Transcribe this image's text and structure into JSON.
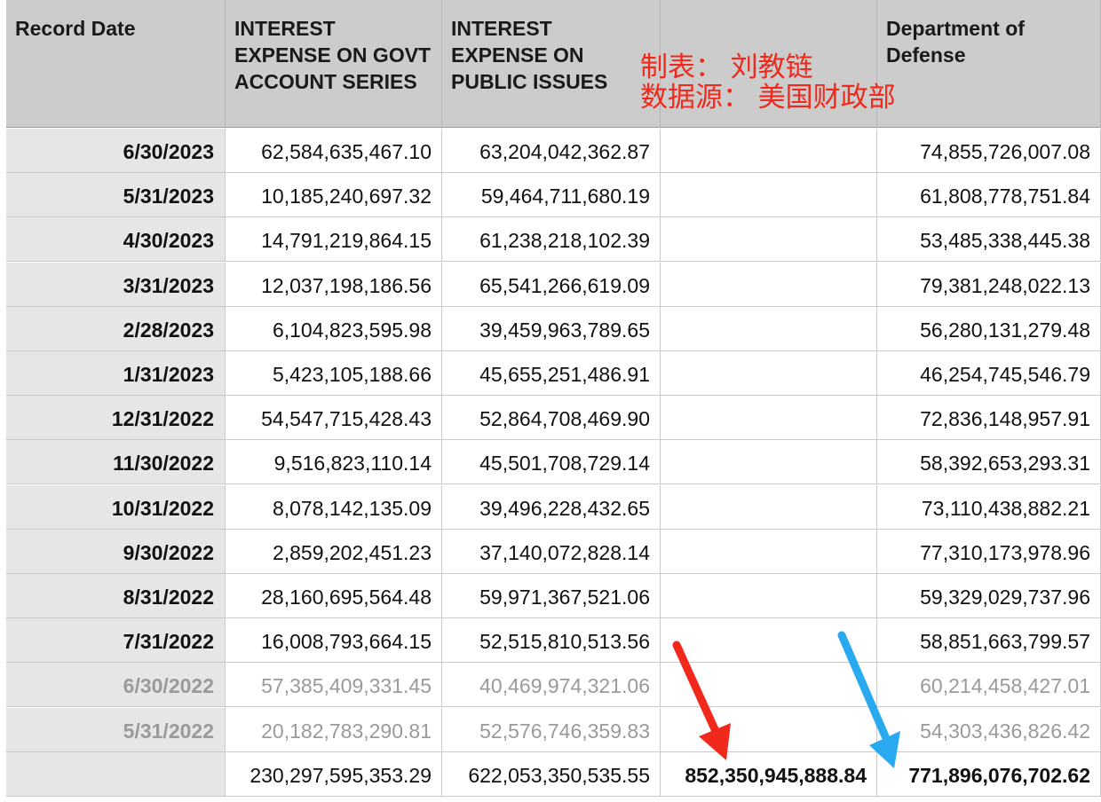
{
  "headers": {
    "record_date": "Record Date",
    "govt_account_series": "INTEREST EXPENSE ON GOVT ACCOUNT SERIES",
    "public_issues": "INTEREST EXPENSE ON PUBLIC ISSUES",
    "total_column": "",
    "defense": "Department of Defense"
  },
  "annotation": {
    "line1": "制表：  刘教链",
    "line2": "数据源：  美国财政部"
  },
  "rows": [
    {
      "date": "6/30/2023",
      "govt": "62,584,635,467.10",
      "public": "63,204,042,362.87",
      "sum": "",
      "defense": "74,855,726,007.08"
    },
    {
      "date": "5/31/2023",
      "govt": "10,185,240,697.32",
      "public": "59,464,711,680.19",
      "sum": "",
      "defense": "61,808,778,751.84"
    },
    {
      "date": "4/30/2023",
      "govt": "14,791,219,864.15",
      "public": "61,238,218,102.39",
      "sum": "",
      "defense": "53,485,338,445.38"
    },
    {
      "date": "3/31/2023",
      "govt": "12,037,198,186.56",
      "public": "65,541,266,619.09",
      "sum": "",
      "defense": "79,381,248,022.13"
    },
    {
      "date": "2/28/2023",
      "govt": "6,104,823,595.98",
      "public": "39,459,963,789.65",
      "sum": "",
      "defense": "56,280,131,279.48"
    },
    {
      "date": "1/31/2023",
      "govt": "5,423,105,188.66",
      "public": "45,655,251,486.91",
      "sum": "",
      "defense": "46,254,745,546.79"
    },
    {
      "date": "12/31/2022",
      "govt": "54,547,715,428.43",
      "public": "52,864,708,469.90",
      "sum": "",
      "defense": "72,836,148,957.91"
    },
    {
      "date": "11/30/2022",
      "govt": "9,516,823,110.14",
      "public": "45,501,708,729.14",
      "sum": "",
      "defense": "58,392,653,293.31"
    },
    {
      "date": "10/31/2022",
      "govt": "8,078,142,135.09",
      "public": "39,496,228,432.65",
      "sum": "",
      "defense": "73,110,438,882.21"
    },
    {
      "date": "9/30/2022",
      "govt": "2,859,202,451.23",
      "public": "37,140,072,828.14",
      "sum": "",
      "defense": "77,310,173,978.96"
    },
    {
      "date": "8/31/2022",
      "govt": "28,160,695,564.48",
      "public": "59,971,367,521.06",
      "sum": "",
      "defense": "59,329,029,737.96"
    },
    {
      "date": "7/31/2022",
      "govt": "16,008,793,664.15",
      "public": "52,515,810,513.56",
      "sum": "",
      "defense": "58,851,663,799.57"
    },
    {
      "date": "6/30/2022",
      "govt": "57,385,409,331.45",
      "public": "40,469,974,321.06",
      "sum": "",
      "defense": "60,214,458,427.01",
      "faded": true
    },
    {
      "date": "5/31/2022",
      "govt": "20,182,783,290.81",
      "public": "52,576,746,359.83",
      "sum": "",
      "defense": "54,303,436,826.42",
      "faded": true
    }
  ],
  "totals": {
    "date": "",
    "govt": "230,297,595,353.29",
    "public": "622,053,350,535.55",
    "sum": "852,350,945,888.84",
    "defense": "771,896,076,702.62"
  },
  "colors": {
    "header_bg": "#cbcccb",
    "date_col_bg": "#e6e6e6",
    "faded_text": "#9a9a9a",
    "annotation_red": "#f0291c",
    "red_arrow": "#f0291c",
    "blue_arrow": "#29aaf0"
  },
  "icons": {
    "red_arrow": "arrow-down-right-red",
    "blue_arrow": "arrow-down-left-blue"
  }
}
